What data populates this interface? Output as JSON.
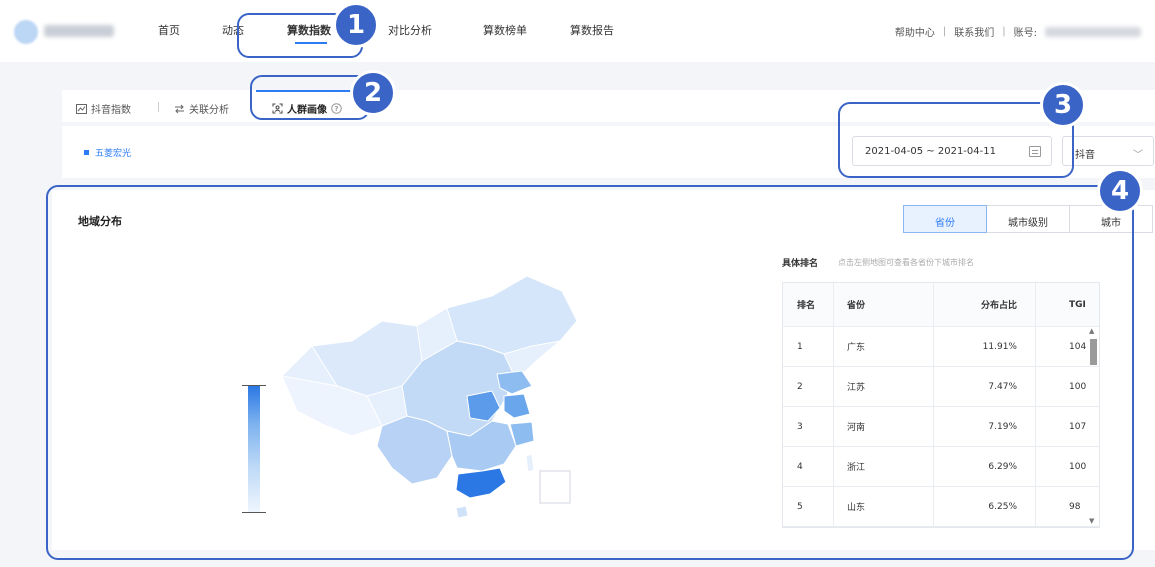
{
  "nav": {
    "items": [
      "首页",
      "动态",
      "算数指数",
      "对比分析",
      "算数榜单",
      "算数报告"
    ],
    "help": "帮助中心",
    "contact": "联系我们",
    "account_prefix": "账号:"
  },
  "subtabs": {
    "items": [
      "抖音指数",
      "关联分析",
      "人群画像"
    ],
    "help_icon": "question-icon"
  },
  "filter": {
    "keyword": "五菱宏光",
    "date_range": "2021-04-05 ~ 2021-04-11",
    "platform": "抖音"
  },
  "region": {
    "title": "地域分布",
    "segments": [
      "省份",
      "城市级别",
      "城市"
    ],
    "active_segment": "省份",
    "rank_title": "具体排名",
    "rank_hint": "点击左侧地图可查看各省份下城市排名",
    "columns": [
      "排名",
      "省份",
      "分布占比",
      "TGI"
    ],
    "rows": [
      {
        "rank": "1",
        "province": "广东",
        "share": "11.91%",
        "tgi": "104"
      },
      {
        "rank": "2",
        "province": "江苏",
        "share": "7.47%",
        "tgi": "100"
      },
      {
        "rank": "3",
        "province": "河南",
        "share": "7.19%",
        "tgi": "107"
      },
      {
        "rank": "4",
        "province": "浙江",
        "share": "6.29%",
        "tgi": "100"
      },
      {
        "rank": "5",
        "province": "山东",
        "share": "6.25%",
        "tgi": "98"
      }
    ],
    "legend_colors": [
      "#2b78e4",
      "#5c9be9",
      "#8dbcf0",
      "#bfdaf7",
      "#e8f2fd"
    ]
  },
  "annotations": [
    "1",
    "2",
    "3",
    "4"
  ],
  "colors": {
    "accent": "#2d7cf6",
    "annotation": "#3b64c7"
  }
}
